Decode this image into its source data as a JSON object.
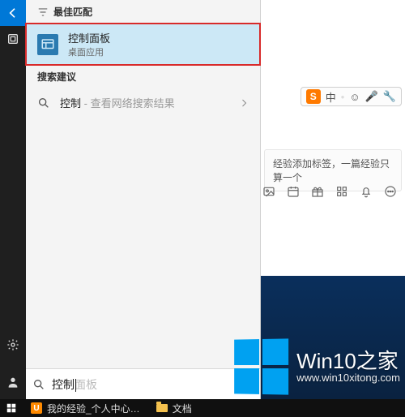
{
  "rail": {
    "back_icon": "back-icon",
    "pin_icon": "pinned-site-icon",
    "settings_icon": "gear-icon",
    "user_icon": "user-icon"
  },
  "search_panel": {
    "best_match_label": "最佳匹配",
    "best_match_filter_icon": "filter-icon",
    "results": [
      {
        "title": "控制面板",
        "subtitle": "桌面应用"
      }
    ],
    "suggestions_label": "搜索建议",
    "suggestion_main": "控制",
    "suggestion_tail": " - 查看网络搜索结果",
    "chevron_icon": "chevron-right-icon",
    "search_icon": "search-icon",
    "search_typed": "控制",
    "search_ghost": "控制面板"
  },
  "right": {
    "ime": {
      "logo_text": "S",
      "char1": "中",
      "sep": "•",
      "face": "☺",
      "mic": "🎤",
      "tool": "🔧"
    },
    "tag_hint": "经验添加标签，一篇经验只算一个",
    "toolbar_icons": [
      "image-icon",
      "calendar-icon",
      "gift-icon",
      "grid-icon",
      "bell-icon",
      "more-icon"
    ]
  },
  "watermark": {
    "title": "Win10之家",
    "url": "www.win10xitong.com"
  },
  "taskbar": {
    "start_icon": "windows-start-icon",
    "items": [
      {
        "icon": "uc-browser-icon",
        "label": "我的经验_个人中心…"
      },
      {
        "icon": "folder-icon",
        "label": "文档"
      }
    ]
  }
}
